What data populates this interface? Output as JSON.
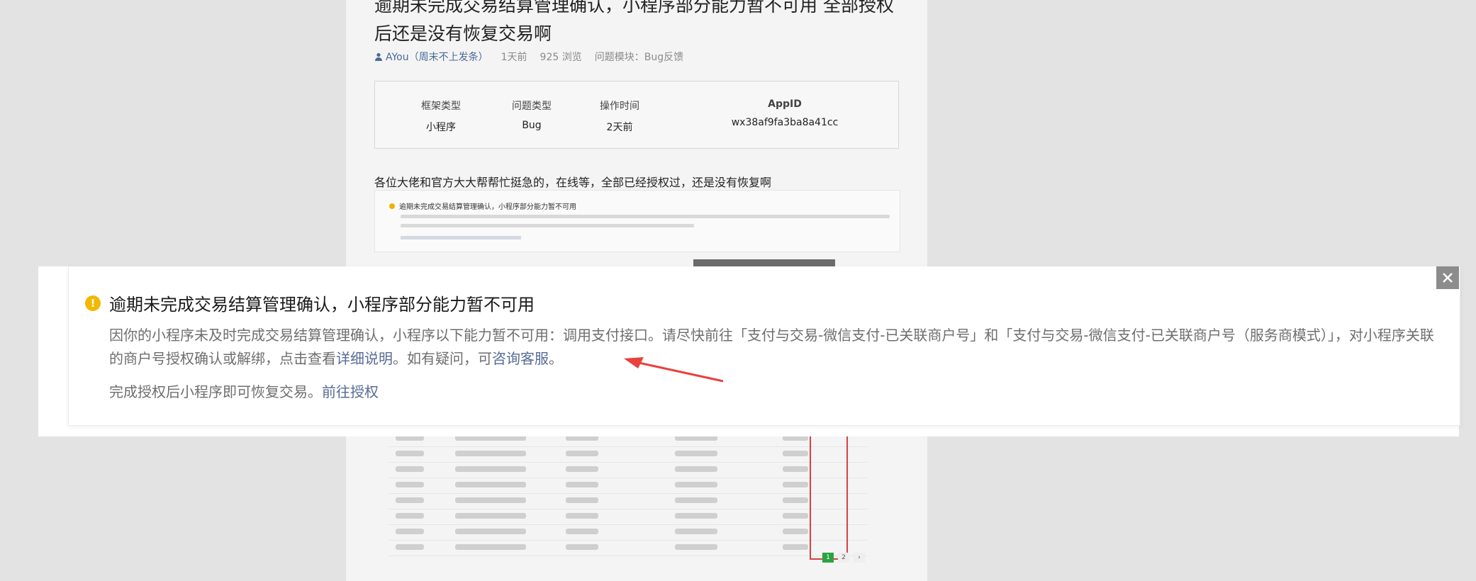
{
  "post": {
    "title": "逾期未完成交易结算管理确认，小程序部分能力暂不可用 全部授权后还是没有恢复交易啊",
    "author": "AYou（周末不上发条）",
    "time": "1天前",
    "views": "925 浏览",
    "module": "问题模块：Bug反馈",
    "body": "各位大佬和官方大大帮帮忙挺急的，在线等，全部已经授权过，还是没有恢复啊",
    "info": [
      {
        "key": "框架类型",
        "value": "小程序"
      },
      {
        "key": "问题类型",
        "value": "Bug"
      },
      {
        "key": "操作时间",
        "value": "2天前"
      },
      {
        "key": "AppID",
        "value": "wx38af9fa3ba8a41cc"
      }
    ],
    "thumb_title": "逾期未完成交易结算管理确认，小程序部分能力暂不可用"
  },
  "modal": {
    "title": "逾期未完成交易结算管理确认，小程序部分能力暂不可用",
    "desc_text": "因你的小程序未及时完成交易结算管理确认，小程序以下能力暂不可用：调用支付接口。请尽快前往「支付与交易-微信支付-已关联商户号」和「支付与交易-微信支付-已关联商户号（服务商模式）」，对小程序关联的商户号授权确认或解绑，点击查看",
    "detail_link": "详细说明",
    "desc_mid": "。如有疑问，可",
    "service_link": "咨询客服",
    "desc_end": "。",
    "foot_text": "完成授权后小程序即可恢复交易。",
    "auth_link": "前往授权",
    "close_label": "✕"
  },
  "pager": [
    "1",
    "2",
    "›"
  ],
  "colors": {
    "warning": "#f3b800",
    "link": "#576b95",
    "arrow": "#e8413e"
  }
}
